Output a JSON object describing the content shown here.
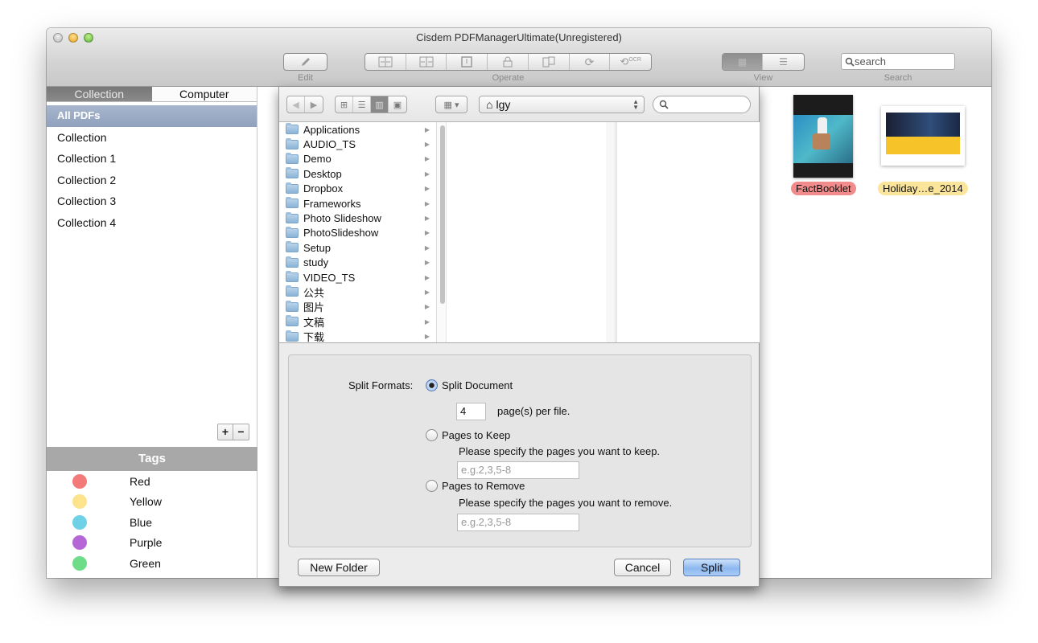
{
  "window": {
    "title": "Cisdem PDFManagerUltimate(Unregistered)"
  },
  "toolbar": {
    "edit_label": "Edit",
    "operate_label": "Operate",
    "view_label": "View",
    "search_label": "Search",
    "search_placeholder": "search",
    "edit_icon": "pencil-icon",
    "operate_icons": [
      "merge-icon",
      "split-icon",
      "page-icon",
      "lock-icon",
      "pages-icon",
      "rotate-icon",
      "ocr-icon"
    ],
    "ocr_text": "OCR",
    "view_icons": [
      "grid-view-icon",
      "list-view-icon"
    ]
  },
  "sidebar": {
    "tabs": [
      {
        "label": "Collection",
        "active": true
      },
      {
        "label": "Computer",
        "active": false
      }
    ],
    "collections": [
      "All PDFs",
      "Collection",
      "Collection 1",
      "Collection 2",
      "Collection 3",
      "Collection 4"
    ],
    "selected": "All PDFs",
    "add_label": "+",
    "remove_label": "−",
    "tags_header": "Tags",
    "tags": [
      {
        "name": "Red",
        "color": "#f47a7a"
      },
      {
        "name": "Yellow",
        "color": "#fde38c"
      },
      {
        "name": "Blue",
        "color": "#6fd1e6"
      },
      {
        "name": "Purple",
        "color": "#b567d6"
      },
      {
        "name": "Green",
        "color": "#6fdc8a"
      }
    ]
  },
  "documents": [
    {
      "name": "FactBooklet",
      "tag_color": "#f28b8b"
    },
    {
      "name": "Holiday…e_2014",
      "tag_color": "#fbe59a"
    }
  ],
  "dialog": {
    "location": "lgy",
    "nav_back": "◀",
    "nav_forward": "▶",
    "folders": [
      "Applications",
      "AUDIO_TS",
      "Demo",
      "Desktop",
      "Dropbox",
      "Frameworks",
      "Photo Slideshow",
      "PhotoSlideshow",
      "Setup",
      "study",
      "VIDEO_TS",
      "公共",
      "图片",
      "文稿",
      "下载"
    ],
    "split_formats_label": "Split Formats:",
    "options": {
      "split_document": {
        "label": "Split Document",
        "selected": true,
        "pages_value": "4",
        "pages_suffix": "page(s) per file."
      },
      "pages_to_keep": {
        "label": "Pages to Keep",
        "selected": false,
        "hint": "Please specify the pages you want to keep.",
        "placeholder": "e.g.2,3,5-8"
      },
      "pages_to_remove": {
        "label": "Pages to Remove",
        "selected": false,
        "hint": "Please specify the pages you want to remove.",
        "placeholder": "e.g.2,3,5-8"
      }
    },
    "new_folder_label": "New Folder",
    "cancel_label": "Cancel",
    "split_label": "Split"
  }
}
